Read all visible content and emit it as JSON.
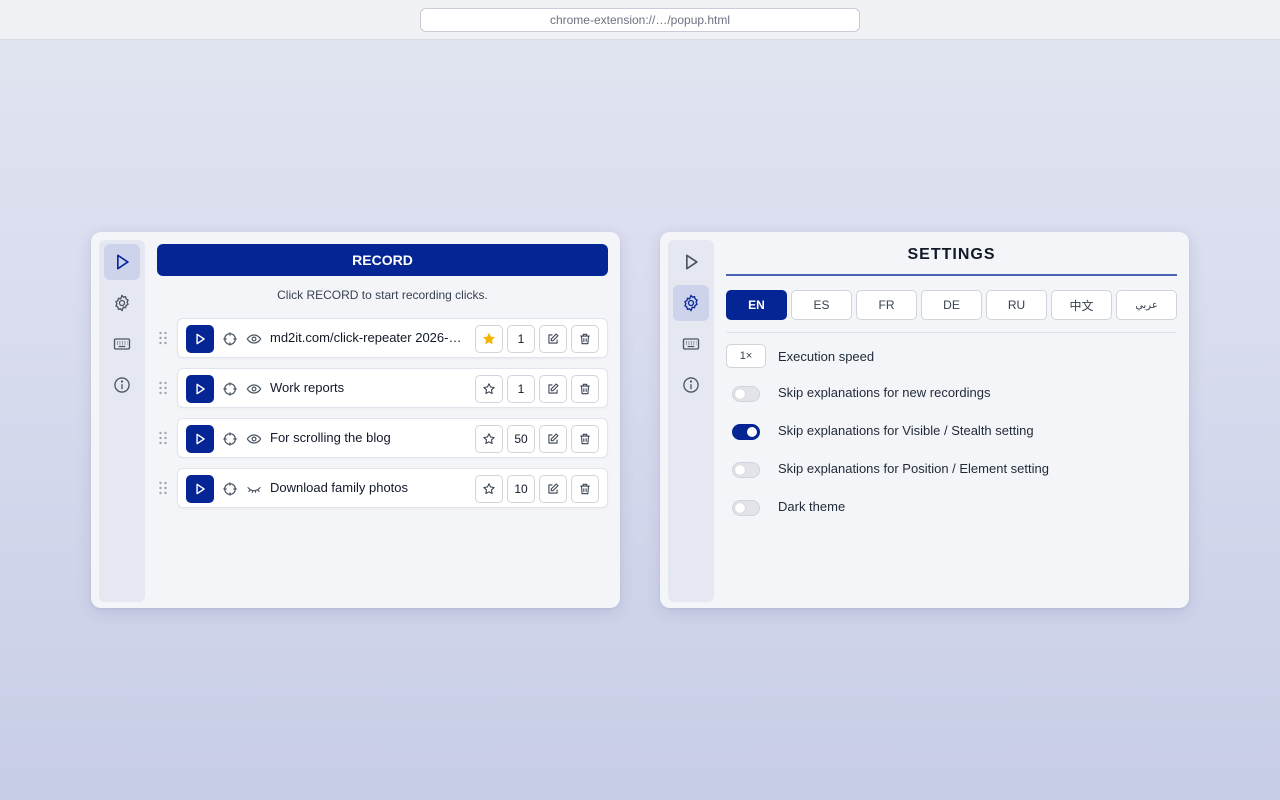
{
  "browser": {
    "url": "chrome-extension://…/popup.html"
  },
  "colors": {
    "primary": "#062594",
    "background": "#f4f5f9",
    "star_fav": "#f5b400"
  },
  "nav": [
    "play-icon",
    "gear-icon",
    "keyboard-icon",
    "info-icon"
  ],
  "recorder": {
    "record_label": "RECORD",
    "hint": "Click RECORD to start recording clicks.",
    "recordings": [
      {
        "name": "md2it.com/click-repeater 2026-…",
        "count": "1",
        "favorite": true,
        "visible": true
      },
      {
        "name": "Work reports",
        "count": "1",
        "favorite": false,
        "visible": true
      },
      {
        "name": "For scrolling the blog",
        "count": "50",
        "favorite": false,
        "visible": true
      },
      {
        "name": "Download family photos",
        "count": "10",
        "favorite": false,
        "visible": false
      }
    ]
  },
  "settings": {
    "title": "SETTINGS",
    "languages": [
      {
        "label": "EN",
        "active": true
      },
      {
        "label": "ES",
        "active": false
      },
      {
        "label": "FR",
        "active": false
      },
      {
        "label": "DE",
        "active": false
      },
      {
        "label": "RU",
        "active": false
      },
      {
        "label": "中文",
        "active": false
      },
      {
        "label": "عربي",
        "active": false
      }
    ],
    "speed_value": "1×",
    "speed_label": "Execution speed",
    "toggles": [
      {
        "label": "Skip explanations for new recordings",
        "on": false
      },
      {
        "label": "Skip explanations for Visible / Stealth setting",
        "on": true
      },
      {
        "label": "Skip explanations for Position / Element setting",
        "on": false
      },
      {
        "label": "Dark theme",
        "on": false
      }
    ]
  }
}
